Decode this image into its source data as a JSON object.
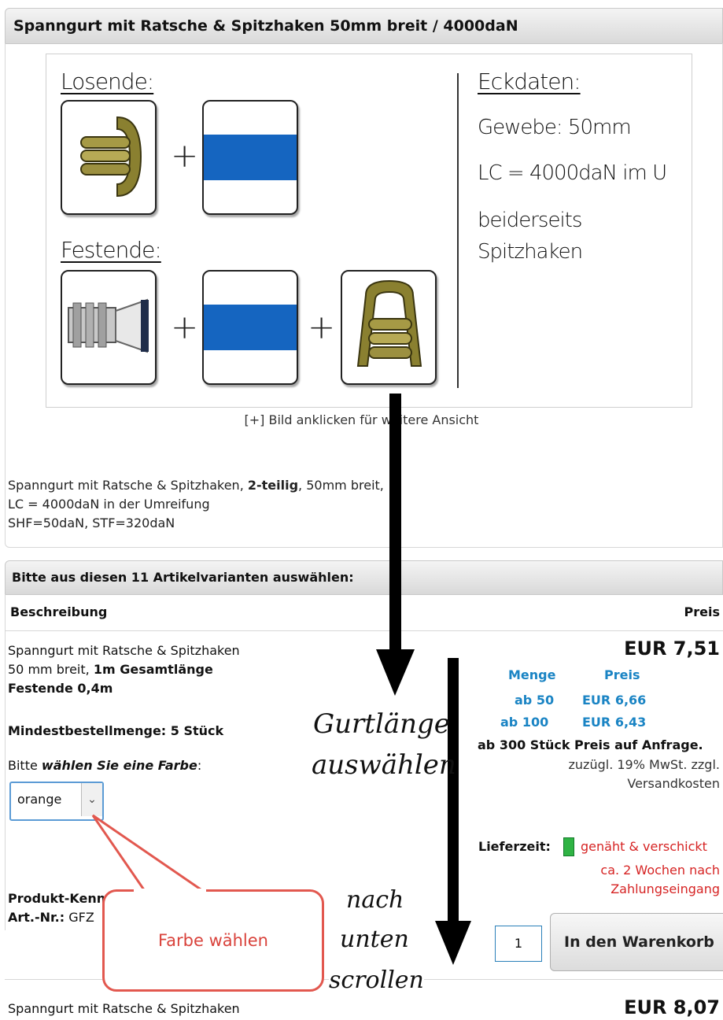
{
  "header": {
    "title": "Spanngurt mit Ratsche & Spitzhaken 50mm breit / 4000daN"
  },
  "product_image": {
    "losende_label": "Losende:",
    "festende_label": "Festende:",
    "plus": "+",
    "eckdaten_title": "Eckdaten:",
    "gewebe": "Gewebe: 50mm",
    "lc": "LC = 4000daN im U",
    "beiderseits_line1": "beiderseits",
    "beiderseits_line2": "Spitzhaken"
  },
  "image_caption": "[+] Bild anklicken für weitere Ansicht",
  "description": {
    "line1_prefix": "Spanngurt mit Ratsche & Spitzhaken, ",
    "line1_bold": "2-teilig",
    "line1_suffix": ", 50mm breit,",
    "line2": "LC = 4000daN in der Umreifung",
    "line3": "SHF=50daN, STF=320daN"
  },
  "variants": {
    "bar_title": "Bitte aus diesen 11 Artikelvarianten auswählen:",
    "col_description": "Beschreibung",
    "col_price": "Preis",
    "item1": {
      "line1": "Spanngurt mit Ratsche & Spitzhaken",
      "line2_prefix": "50 mm breit, ",
      "line2_bold": "1m Gesamtlänge",
      "line3": "Festende 0,4m",
      "min_order": "Mindestbestellmenge: 5 Stück",
      "choose_prefix": "Bitte ",
      "choose_em": "wählen Sie eine Farbe",
      "choose_suffix": ":",
      "color_selected": "orange",
      "product_ident_label": "Produkt-Kennzeichnungen:",
      "art_nr_label": "Art.-Nr.:",
      "art_nr_value": "GFZ",
      "price": "EUR 7,51",
      "scale_head_qty": "Menge",
      "scale_head_price": "Preis",
      "scale_rows": [
        {
          "qty": "ab 50",
          "price": "EUR 6,66"
        },
        {
          "qty": "ab 100",
          "price": "EUR 6,43"
        }
      ],
      "request_note": "ab 300 Stück Preis auf Anfrage.",
      "tax_note_1": "zuzügl. 19% MwSt. zzgl.",
      "tax_note_2": "Versandkosten",
      "delivery_label": "Lieferzeit:",
      "delivery_text_1": "genäht & verschickt",
      "delivery_text_2": "ca. 2 Wochen nach",
      "delivery_text_3": "Zahlungseingang",
      "quantity": "1",
      "cart_button": "In den Warenkorb"
    },
    "item2": {
      "line1": "Spanngurt mit Ratsche & Spitzhaken",
      "price": "EUR 8,07"
    }
  },
  "annotations": {
    "callout": "Farbe wählen",
    "gurtlaenge_1": "Gurtlänge",
    "gurtlaenge_2": "auswählen",
    "scroll_1": "nach",
    "scroll_2": "unten",
    "scroll_3": "scrollen"
  },
  "colors": {
    "accent_blue": "#1a84c4",
    "strap_blue": "#1565c0",
    "delivery_red": "#d62323",
    "callout_red": "#e2584f",
    "stock_green": "#2fb344"
  },
  "icons": [
    "dropdown-arrow-icon",
    "stock-indicator-icon",
    "down-arrow-icon"
  ]
}
